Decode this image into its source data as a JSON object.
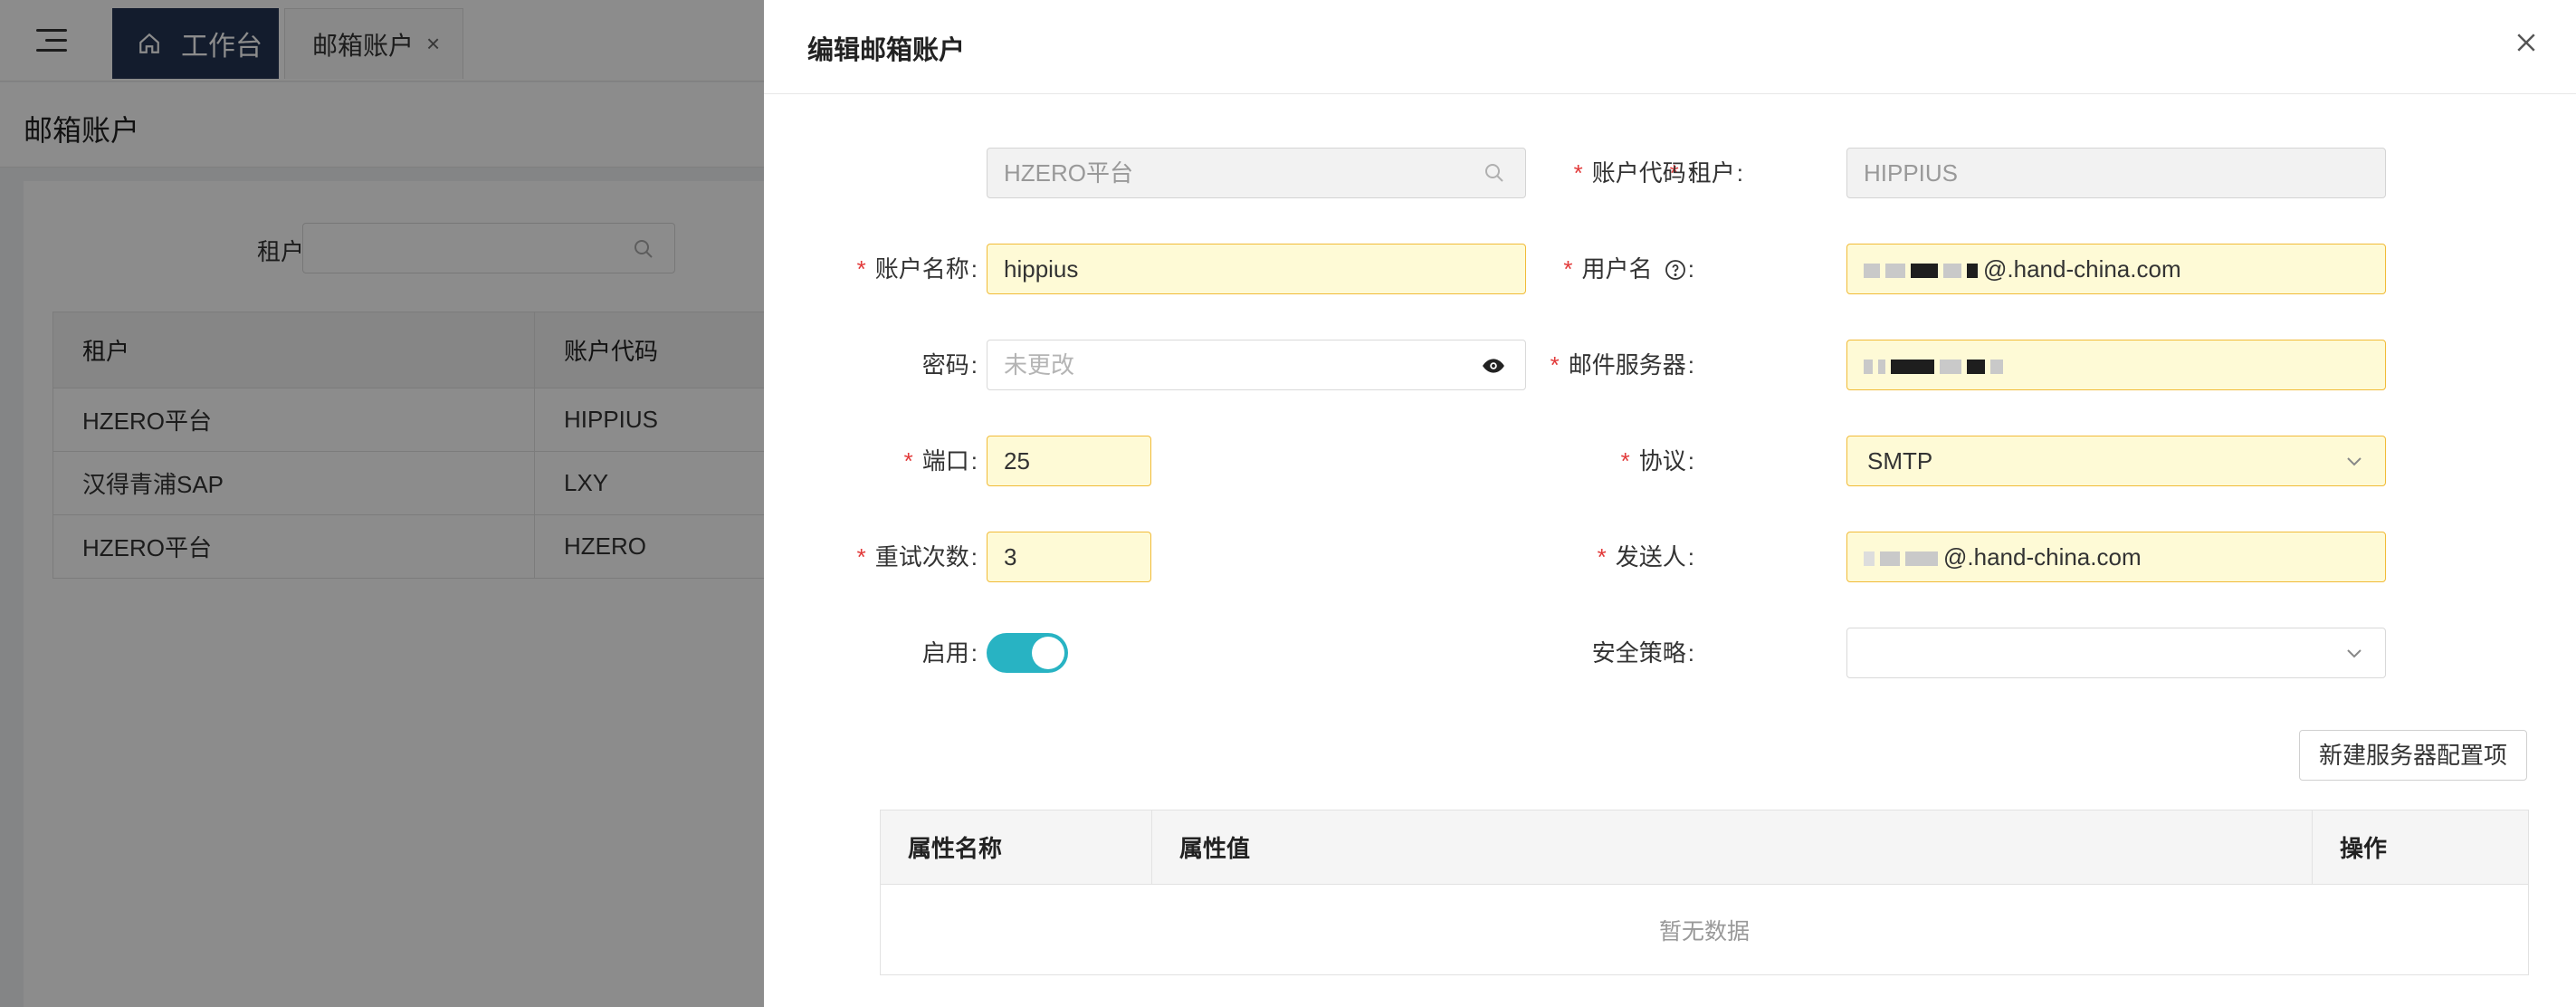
{
  "topbar": {
    "tabs": [
      {
        "label": "工作台"
      },
      {
        "label": "邮箱账户",
        "close": "×"
      }
    ]
  },
  "page": {
    "title": "邮箱账户",
    "filter": {
      "tenant_label": "租户 :",
      "tenant_value": ""
    },
    "table": {
      "headers": [
        "租户",
        "账户代码"
      ],
      "rows": [
        [
          "HZERO平台",
          "HIPPIUS"
        ],
        [
          "汉得青浦SAP",
          "LXY"
        ],
        [
          "HZERO平台",
          "HZERO"
        ]
      ]
    }
  },
  "drawer": {
    "title": "编辑邮箱账户",
    "required_mark": "*",
    "fields": {
      "tenant": {
        "label": "租户",
        "value": "HZERO平台"
      },
      "account_code": {
        "label": "账户代码",
        "value": "HIPPIUS"
      },
      "account_name": {
        "label": "账户名称",
        "value": "hippius"
      },
      "username": {
        "label": "用户名",
        "value_suffix": "@.hand-china.com"
      },
      "password": {
        "label": "密码",
        "placeholder": "未更改"
      },
      "mail_server": {
        "label": "邮件服务器"
      },
      "port": {
        "label": "端口",
        "value": "25"
      },
      "protocol": {
        "label": "协议",
        "value": "SMTP"
      },
      "retry_count": {
        "label": "重试次数",
        "value": "3"
      },
      "sender": {
        "label": "发送人",
        "value_suffix": "@.hand-china.com"
      },
      "enabled": {
        "label": "启用",
        "on": true
      },
      "security_policy": {
        "label": "安全策略",
        "value": ""
      }
    },
    "new_config_button": "新建服务器配置项",
    "config_table": {
      "headers": [
        "属性名称",
        "属性值",
        "操作"
      ],
      "empty_text": "暂无数据"
    }
  },
  "colors": {
    "accent": "#28b3c3",
    "nav_dark": "#233453",
    "required": "#e23a3a",
    "required_field_bg": "#fefad6",
    "required_field_border": "#f1bb38"
  }
}
